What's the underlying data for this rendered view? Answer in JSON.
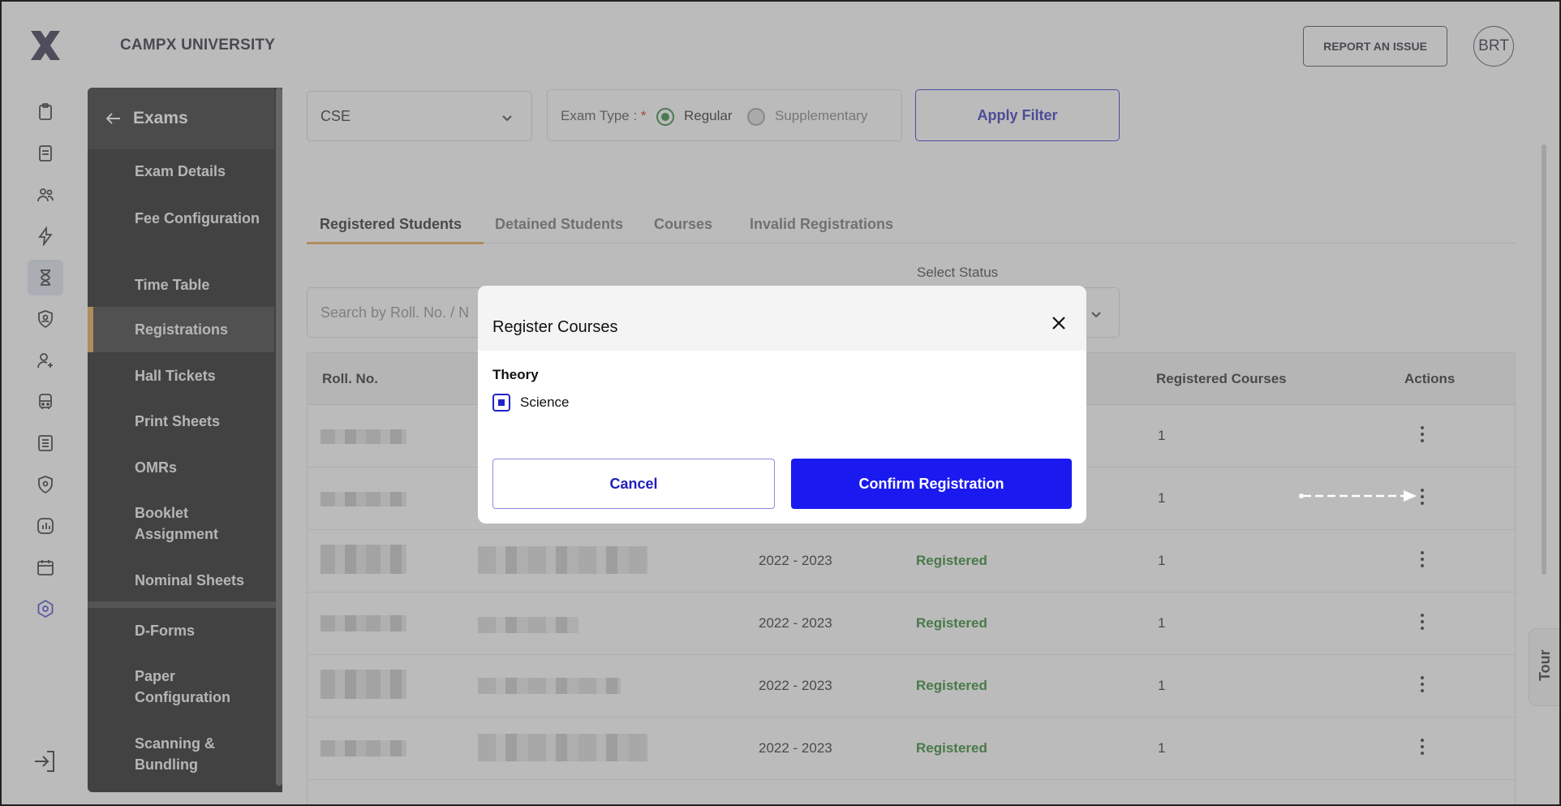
{
  "app": {
    "title": "CAMPX UNIVERSITY",
    "report_label": "REPORT AN ISSUE",
    "avatar_initials": "BRT"
  },
  "sidebar": {
    "title": "Exams",
    "items": [
      {
        "label": "Exam Details"
      },
      {
        "label": "Fee Configuration"
      },
      {
        "label": "Time Table"
      },
      {
        "label": "Registrations",
        "active": true
      },
      {
        "label": "Hall Tickets"
      },
      {
        "label": "Print Sheets"
      },
      {
        "label": "OMRs"
      },
      {
        "label": "Booklet Assignment"
      },
      {
        "label": "Nominal Sheets"
      },
      {
        "label": "D-Forms"
      },
      {
        "label": "Paper Configuration"
      },
      {
        "label": "Scanning & Bundling"
      }
    ]
  },
  "filters": {
    "branch": "CSE",
    "exam_type_label": "Exam Type :",
    "required_mark": "*",
    "exam_type_options": [
      "Regular",
      "Supplementary"
    ],
    "exam_type_selected": "Regular",
    "apply_label": "Apply Filter"
  },
  "tabs": [
    "Registered Students",
    "Detained Students",
    "Courses",
    "Invalid Registrations"
  ],
  "search": {
    "placeholder": "Search by Roll. No. / N",
    "status_label": "Select Status"
  },
  "table": {
    "columns": [
      "Roll. No.",
      "Registered Courses",
      "Actions"
    ],
    "rows": [
      {
        "year": "",
        "status": "",
        "courses": "1"
      },
      {
        "year": "",
        "status": "",
        "courses": "1"
      },
      {
        "year": "2022 - 2023",
        "status": "Registered",
        "courses": "1"
      },
      {
        "year": "2022 - 2023",
        "status": "Registered",
        "courses": "1"
      },
      {
        "year": "2022 - 2023",
        "status": "Registered",
        "courses": "1"
      },
      {
        "year": "2022 - 2023",
        "status": "Registered",
        "courses": "1"
      }
    ]
  },
  "tour_label": "Tour",
  "modal": {
    "title": "Register Courses",
    "section": "Theory",
    "course": "Science",
    "course_checked": true,
    "cancel_label": "Cancel",
    "confirm_label": "Confirm Registration"
  },
  "colors": {
    "accent": "#1a1af0",
    "active_tab": "#e8a33c",
    "status_registered": "#1a7a1a"
  },
  "icons": {
    "rail": [
      "clipboard-icon",
      "notebook-icon",
      "users-icon",
      "bolt-icon",
      "hourglass-icon",
      "shield-user-icon",
      "user-add-icon",
      "bus-icon",
      "list-icon",
      "location-shield-icon",
      "chart-icon",
      "calendar-icon",
      "settings-hex-icon"
    ]
  }
}
